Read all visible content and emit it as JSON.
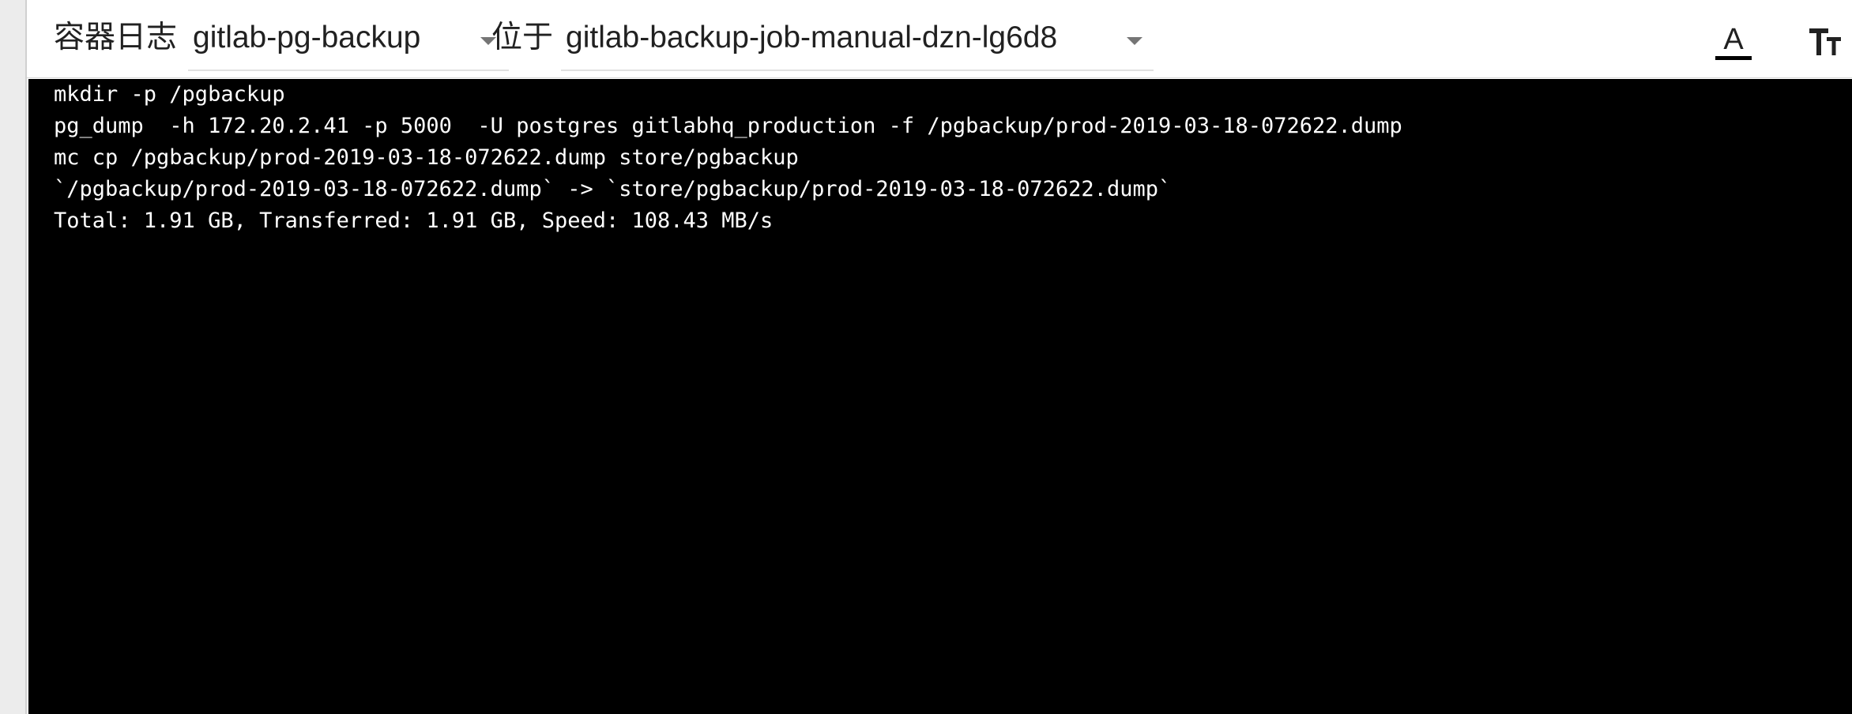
{
  "toolbar": {
    "container_logs_label": "容器日志",
    "container_select": {
      "value": "gitlab-pg-backup"
    },
    "located_in_label": "位于",
    "pod_select": {
      "value": "gitlab-backup-job-manual-dzn-lg6d8"
    },
    "icons": {
      "text_color": "text-color-icon",
      "text_size": "text-size-icon"
    }
  },
  "log": {
    "lines": [
      "mkdir -p /pgbackup",
      "pg_dump  -h 172.20.2.41 -p 5000  -U postgres gitlabhq_production -f /pgbackup/prod-2019-03-18-072622.dump",
      "mc cp /pgbackup/prod-2019-03-18-072622.dump store/pgbackup",
      "`/pgbackup/prod-2019-03-18-072622.dump` -> `store/pgbackup/prod-2019-03-18-072622.dump`",
      "Total: 1.91 GB, Transferred: 1.91 GB, Speed: 108.43 MB/s"
    ]
  },
  "colors": {
    "terminal_background": "#000000",
    "terminal_text": "#ffffff",
    "toolbar_background": "#ffffff",
    "text": "#212121"
  }
}
